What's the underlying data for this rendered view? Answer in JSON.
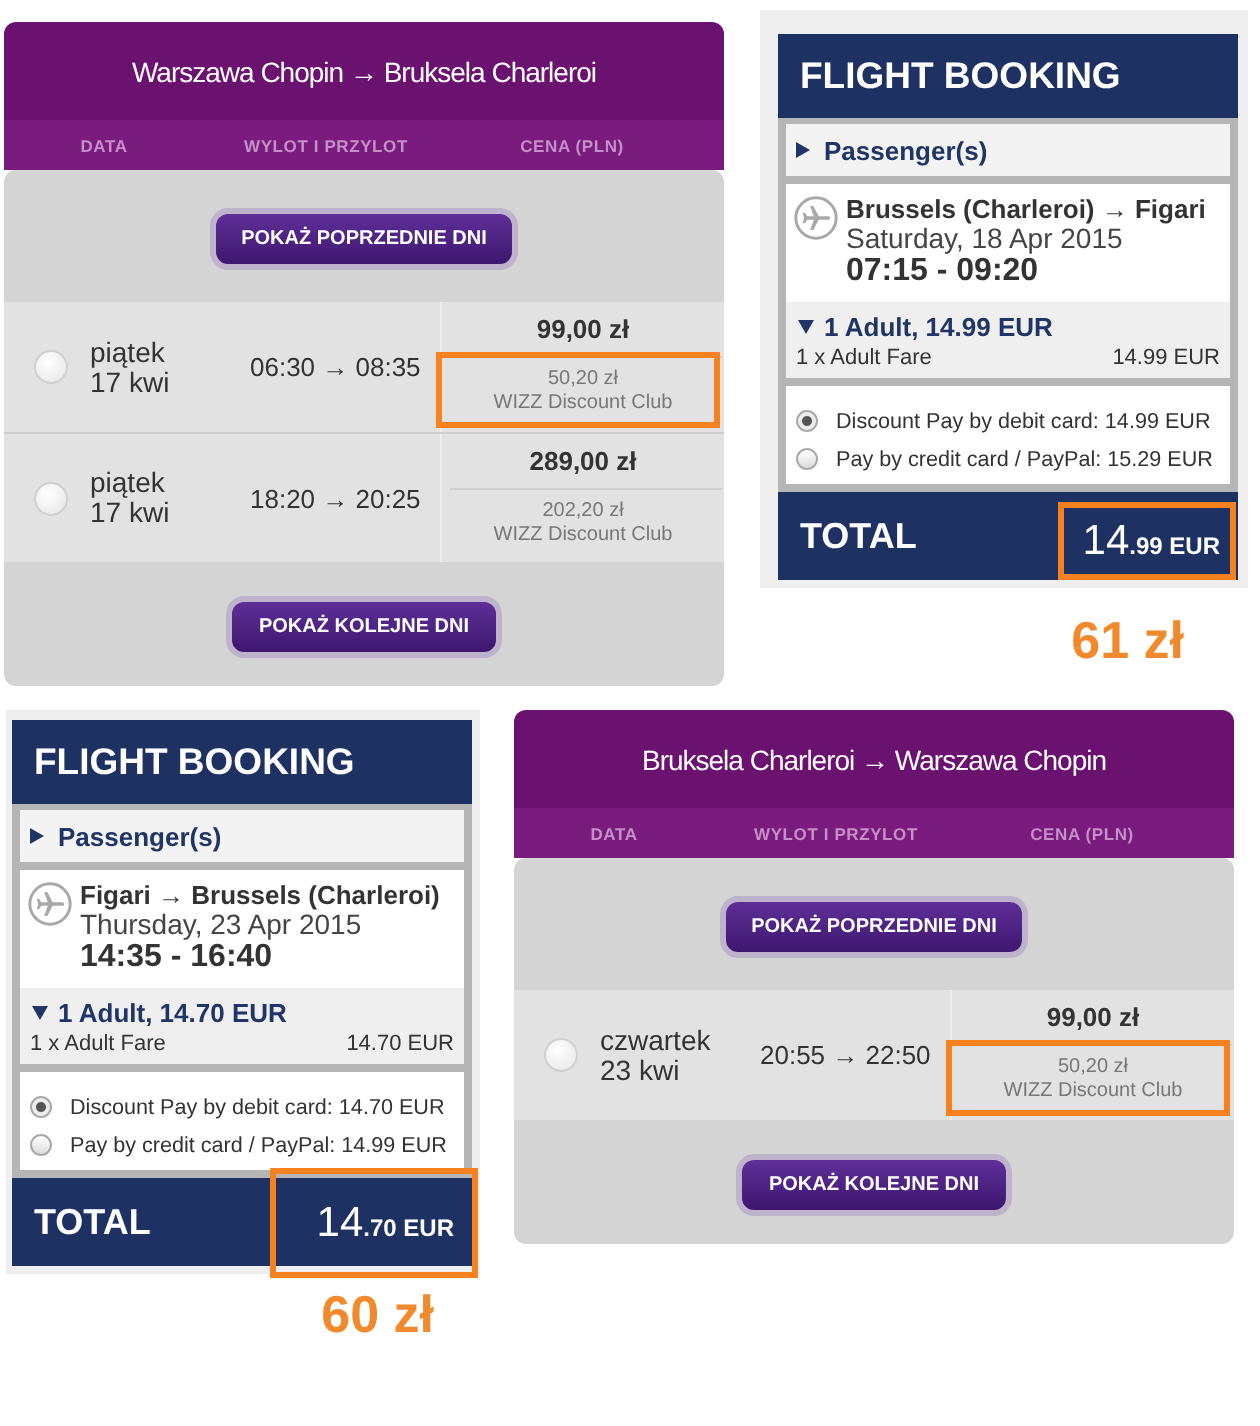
{
  "panels": [
    {
      "kind": "fare_calendar",
      "title": "Warszawa Chopin → Bruksela Charleroi",
      "columns": [
        "DATA",
        "WYLOT I PRZYLOT",
        "CENA (PLN)"
      ],
      "previous_button": "POKAŻ POPRZEDNIE DNI",
      "flights": [
        {
          "day": "piątek",
          "date": "17 kwi",
          "times": "06:30 → 08:35",
          "price": "99,00 zł",
          "discount_price": "50,20 zł",
          "discount_label": "WIZZ Discount Club",
          "selected": false,
          "highlighted": true
        },
        {
          "day": "piątek",
          "date": "17 kwi",
          "times": "18:20 → 20:25",
          "price": "289,00 zł",
          "discount_price": "202,20 zł",
          "discount_label": "WIZZ Discount Club",
          "selected": false,
          "highlighted": false
        }
      ],
      "next_button": "POKAŻ KOLEJNE DNI"
    },
    {
      "kind": "booking_summary",
      "title": "FLIGHT BOOKING",
      "passengers": {
        "label": "Passenger(s)",
        "expanded": false
      },
      "flight": {
        "route": "Brussels (Charleroi) → Figari",
        "date": "Saturday, 18 Apr 2015",
        "times": "07:15 - 09:20"
      },
      "fare": {
        "summary": "1 Adult, 14.99 EUR",
        "expanded": true,
        "lines": [
          {
            "label": "1 x Adult Fare",
            "amount": "14.99 EUR"
          }
        ]
      },
      "payment_options": [
        {
          "label": "Discount Pay by debit card: 14.99 EUR",
          "selected": true
        },
        {
          "label": "Pay by credit card / PayPal: 15.29 EUR",
          "selected": false
        }
      ],
      "total": {
        "label": "TOTAL",
        "amount": "14",
        "decimals": ".99",
        "currency": "EUR",
        "highlighted": true
      },
      "annotation": "61 zł"
    },
    {
      "kind": "booking_summary",
      "title": "FLIGHT BOOKING",
      "passengers": {
        "label": "Passenger(s)",
        "expanded": false
      },
      "flight": {
        "route": "Figari → Brussels (Charleroi)",
        "date": "Thursday, 23 Apr 2015",
        "times": "14:35 - 16:40"
      },
      "fare": {
        "summary": "1 Adult, 14.70 EUR",
        "expanded": true,
        "lines": [
          {
            "label": "1 x Adult Fare",
            "amount": "14.70 EUR"
          }
        ]
      },
      "payment_options": [
        {
          "label": "Discount Pay by debit card: 14.70 EUR",
          "selected": true
        },
        {
          "label": "Pay by credit card / PayPal: 14.99 EUR",
          "selected": false
        }
      ],
      "total": {
        "label": "TOTAL",
        "amount": "14",
        "decimals": ".70",
        "currency": "EUR",
        "highlighted": true
      },
      "annotation": "60 zł"
    },
    {
      "kind": "fare_calendar",
      "title": "Bruksela Charleroi → Warszawa Chopin",
      "columns": [
        "DATA",
        "WYLOT I PRZYLOT",
        "CENA (PLN)"
      ],
      "previous_button": "POKAŻ POPRZEDNIE DNI",
      "flights": [
        {
          "day": "czwartek",
          "date": "23 kwi",
          "times": "20:55 → 22:50",
          "price": "99,00 zł",
          "discount_price": "50,20 zł",
          "discount_label": "WIZZ Discount Club",
          "selected": false,
          "highlighted": true
        }
      ],
      "next_button": "POKAŻ KOLEJNE DNI"
    }
  ]
}
